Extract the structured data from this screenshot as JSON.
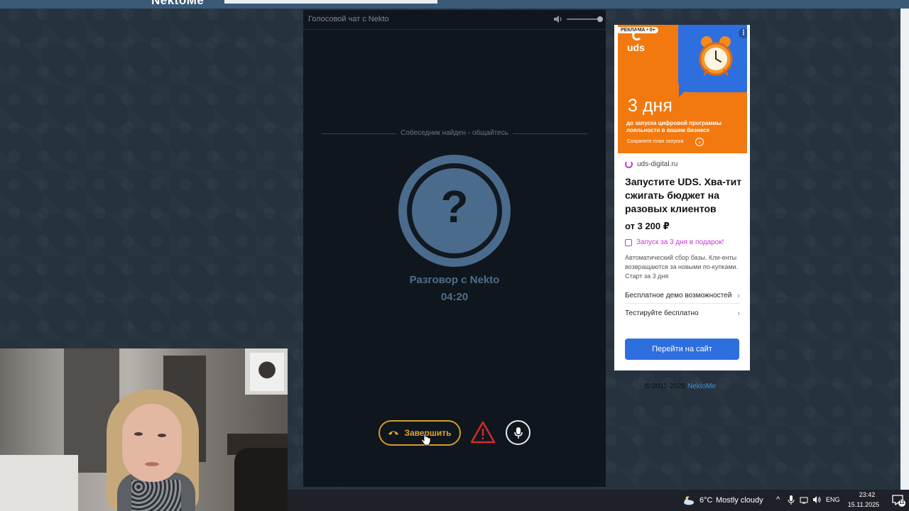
{
  "site": {
    "logo": "NektoMe",
    "url": ""
  },
  "chat": {
    "title": "Голосовой чат с Nekto",
    "found_status": "Собеседник найден - общайтесь",
    "avatar_symbol": "?",
    "conversation_title": "Разговор с Nekto",
    "timer": "04:20",
    "end_button_label": "Завершить",
    "volume_level": 1.0,
    "icons": {
      "volume": "speaker-icon",
      "end": "phone-hangup-icon",
      "report": "warning-triangle-icon",
      "mic": "microphone-icon"
    }
  },
  "ad": {
    "badge": "РЕКЛАМА • 0+",
    "more": "⋮",
    "brand": "uds",
    "big_text": "3 дня",
    "sub_text": "до запуска цифровой программы лояльности в вашем бизнесе",
    "save_text": "Сохраните план запуска",
    "domain": "uds-digital.ru",
    "headline": "Запустите UDS. Хва-тит сжигать бюджет на разовых клиентов",
    "price": "от 3 200 ₽",
    "promo": "Запуск за 3 дня в подарок!",
    "description": "Автоматический сбор базы. Кли-енты возвращаются за новыми по-купками. Старт за 3 дня",
    "links": [
      {
        "label": "Бесплатное демо возможностей"
      },
      {
        "label": "Тестируйте бесплатно"
      }
    ],
    "cta": "Перейти на сайт",
    "colors": {
      "orange": "#f2790f",
      "blue": "#2e6fe0",
      "accent": "#c23ad6"
    }
  },
  "footer": {
    "copyright": "© 2011-2025",
    "link": "NektoMe"
  },
  "taskbar": {
    "temperature": "6°C",
    "condition": "Mostly cloudy",
    "tray_chevron": "^",
    "language": "ENG",
    "time": "23:42",
    "date": "15.11.2025",
    "notification_count": "11"
  },
  "colors": {
    "end_button": "#d49b2a",
    "avatar": "#4a6b8c",
    "panel_bg": "#10161d"
  }
}
